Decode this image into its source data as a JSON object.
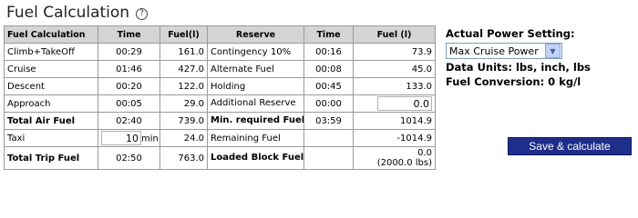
{
  "title": "Fuel Calculation",
  "help_icon_glyph": "?",
  "table": {
    "headers": [
      "Fuel Calculation",
      "Time",
      "Fuel(l)",
      "Reserve",
      "Time",
      "Fuel (l)"
    ],
    "rows": [
      {
        "label": "Climb+TakeOff",
        "time": "00:29",
        "fuel": "161.0",
        "reserve": "Contingency 10%",
        "rtime": "00:16",
        "rfuel": "73.9"
      },
      {
        "label": "Cruise",
        "time": "01:46",
        "fuel": "427.0",
        "reserve": "Alternate Fuel",
        "rtime": "00:08",
        "rfuel": "45.0"
      },
      {
        "label": "Descent",
        "time": "00:20",
        "fuel": "122.0",
        "reserve": "Holding",
        "rtime": "00:45",
        "rfuel": "133.0"
      },
      {
        "label": "Approach",
        "time": "00:05",
        "fuel": "29.0",
        "reserve": "Additional Reserve",
        "rtime": "00:00",
        "rfuel": "0.0"
      },
      {
        "label": "Total Air Fuel",
        "time": "02:40",
        "fuel": "739.0",
        "reserve": "Min. required Fuel",
        "rtime": "03:59",
        "rfuel": "1014.9"
      },
      {
        "label": "Taxi",
        "time": "10",
        "time_unit": "min",
        "fuel": "24.0",
        "reserve": "Remaining Fuel",
        "rtime": "",
        "rfuel": "-1014.9"
      },
      {
        "label": "Total Trip Fuel",
        "time": "02:50",
        "fuel": "763.0",
        "reserve": "Loaded Block Fuel",
        "rtime": "",
        "rfuel": "0.0",
        "rfuel_sub": "(2000.0 lbs)"
      }
    ]
  },
  "side": {
    "power_label": "Actual Power Setting:",
    "power_value": "Max Cruise Power",
    "units": "Data Units: lbs, inch, lbs",
    "conversion": "Fuel Conversion: 0 kg/l"
  },
  "save_label": "Save & calculate"
}
